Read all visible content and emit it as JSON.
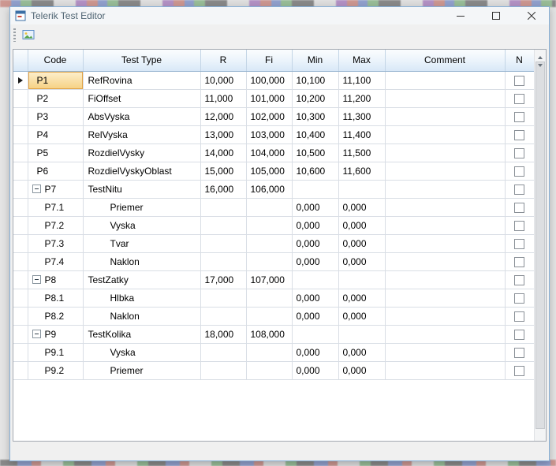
{
  "window": {
    "title": "Telerik Test Editor"
  },
  "icons": {
    "app": "application-icon",
    "minimize": "minimize-icon",
    "maximize": "maximize-icon",
    "close": "close-icon",
    "toolbar_button": "image-icon",
    "row_current": "current-row-arrow-icon",
    "group_toggle": "collapse-icon"
  },
  "colors": {
    "window_border": "#86b0d8",
    "header_gradient_bottom": "#d8e8f7",
    "current_cell_fill": "#f6d184",
    "current_cell_border": "#e2a243"
  },
  "grid": {
    "columns": [
      "Code",
      "Test Type",
      "R",
      "Fi",
      "Min",
      "Max",
      "Comment",
      "N"
    ],
    "rows": [
      {
        "kind": "root",
        "current": true,
        "code": "P1",
        "type": "RefRovina",
        "r": "10,000",
        "fi": "100,000",
        "min": "10,100",
        "max": "11,100",
        "comment": "",
        "checked": false
      },
      {
        "kind": "root",
        "code": "P2",
        "type": "FiOffset",
        "r": "11,000",
        "fi": "101,000",
        "min": "10,200",
        "max": "11,200",
        "comment": "",
        "checked": false
      },
      {
        "kind": "root",
        "code": "P3",
        "type": "AbsVyska",
        "r": "12,000",
        "fi": "102,000",
        "min": "10,300",
        "max": "11,300",
        "comment": "",
        "checked": false
      },
      {
        "kind": "root",
        "code": "P4",
        "type": "RelVyska",
        "r": "13,000",
        "fi": "103,000",
        "min": "10,400",
        "max": "11,400",
        "comment": "",
        "checked": false
      },
      {
        "kind": "root",
        "code": "P5",
        "type": "RozdielVysky",
        "r": "14,000",
        "fi": "104,000",
        "min": "10,500",
        "max": "11,500",
        "comment": "",
        "checked": false
      },
      {
        "kind": "root",
        "code": "P6",
        "type": "RozdielVyskyOblast",
        "r": "15,000",
        "fi": "105,000",
        "min": "10,600",
        "max": "11,600",
        "comment": "",
        "checked": false
      },
      {
        "kind": "group",
        "expanded": true,
        "code": "P7",
        "type": "TestNitu",
        "r": "16,000",
        "fi": "106,000",
        "min": "",
        "max": "",
        "comment": "",
        "checked": false
      },
      {
        "kind": "child",
        "code": "P7.1",
        "type": "Priemer",
        "r": "",
        "fi": "",
        "min": "0,000",
        "max": "0,000",
        "comment": "",
        "checked": false
      },
      {
        "kind": "child",
        "code": "P7.2",
        "type": "Vyska",
        "r": "",
        "fi": "",
        "min": "0,000",
        "max": "0,000",
        "comment": "",
        "checked": false
      },
      {
        "kind": "child",
        "code": "P7.3",
        "type": "Tvar",
        "r": "",
        "fi": "",
        "min": "0,000",
        "max": "0,000",
        "comment": "",
        "checked": false
      },
      {
        "kind": "child",
        "code": "P7.4",
        "type": "Naklon",
        "r": "",
        "fi": "",
        "min": "0,000",
        "max": "0,000",
        "comment": "",
        "checked": false
      },
      {
        "kind": "group",
        "expanded": true,
        "code": "P8",
        "type": "TestZatky",
        "r": "17,000",
        "fi": "107,000",
        "min": "",
        "max": "",
        "comment": "",
        "checked": false
      },
      {
        "kind": "child",
        "code": "P8.1",
        "type": "Hlbka",
        "r": "",
        "fi": "",
        "min": "0,000",
        "max": "0,000",
        "comment": "",
        "checked": false
      },
      {
        "kind": "child",
        "code": "P8.2",
        "type": "Naklon",
        "r": "",
        "fi": "",
        "min": "0,000",
        "max": "0,000",
        "comment": "",
        "checked": false
      },
      {
        "kind": "group",
        "expanded": true,
        "code": "P9",
        "type": "TestKolika",
        "r": "18,000",
        "fi": "108,000",
        "min": "",
        "max": "",
        "comment": "",
        "checked": false
      },
      {
        "kind": "child",
        "code": "P9.1",
        "type": "Vyska",
        "r": "",
        "fi": "",
        "min": "0,000",
        "max": "0,000",
        "comment": "",
        "checked": false
      },
      {
        "kind": "child",
        "code": "P9.2",
        "type": "Priemer",
        "r": "",
        "fi": "",
        "min": "0,000",
        "max": "0,000",
        "comment": "",
        "checked": false
      }
    ]
  }
}
